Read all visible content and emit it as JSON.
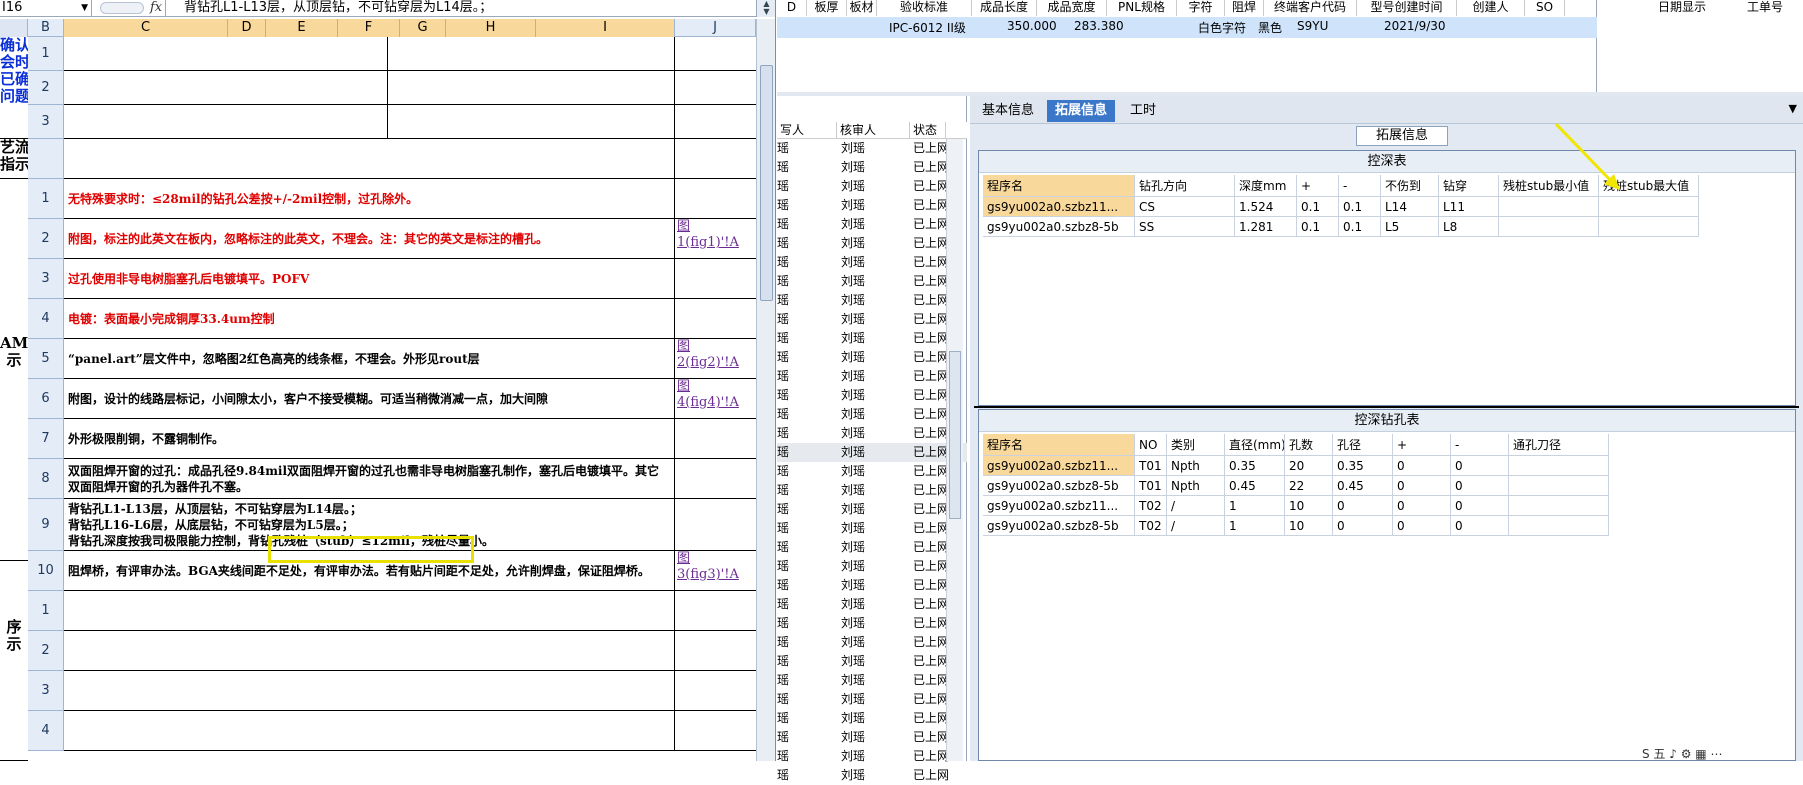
{
  "formula_bar": {
    "name_box": "I16",
    "fx": "fx",
    "formula": "背钻孔L1-L13层，从顶层钻，不可钻穿层为L14层。；"
  },
  "sheet": {
    "columns": [
      "B",
      "C",
      "D",
      "E",
      "F",
      "G",
      "H",
      "I",
      "J"
    ],
    "selected_columns": [
      "C",
      "D",
      "E",
      "F",
      "G",
      "H",
      "I"
    ],
    "left_labels": [
      {
        "text": "确认\n会时\n已确\n问题"
      },
      {
        "text": "艺流程\n指示"
      },
      {
        "text": "AM\n示"
      },
      {
        "text": "序\n示"
      }
    ],
    "rows": [
      {
        "num": "1",
        "text": "",
        "link": "",
        "red": false
      },
      {
        "num": "2",
        "text": "",
        "link": "",
        "red": false
      },
      {
        "num": "3",
        "text": "",
        "link": "",
        "red": false
      },
      {
        "num": "",
        "text": "",
        "link": "",
        "red": false
      },
      {
        "num": "1",
        "text": "无特殊要求时：≤28mil的钻孔公差按+/-2mil控制，过孔除外。",
        "link": "",
        "red": true
      },
      {
        "num": "2",
        "text": "附图，标注的此英文在板内，忽略标注的此英文，不理会。注：其它的英文是标注的槽孔。",
        "link": "图\n1(fig1)'!A",
        "red": true
      },
      {
        "num": "3",
        "text": "过孔使用非导电树脂塞孔后电镀填平。POFV",
        "link": "",
        "red": true
      },
      {
        "num": "4",
        "text": "电镀：表面最小完成铜厚33.4um控制",
        "link": "",
        "red": true
      },
      {
        "num": "5",
        "text": "“panel.art”层文件中，忽略图2红色高亮的线条框，不理会。外形见rout层",
        "link": "图\n2(fig2)'!A",
        "red": false
      },
      {
        "num": "6",
        "text": "附图，设计的线路层标记，小间隙太小，客户不接受模糊。可适当稍微消减一点，加大间隙",
        "link": "图\n4(fig4)'!A",
        "red": false
      },
      {
        "num": "7",
        "text": "外形极限削铜，不露铜制作。",
        "link": "",
        "red": false
      },
      {
        "num": "8",
        "text": "双面阻焊开窗的过孔：成品孔径9.84mil双面阻焊开窗的过孔也需非导电树脂塞孔制作，塞孔后电镀填平。其它双面阻焊开窗的孔为器件孔不塞。",
        "link": "",
        "red": false
      },
      {
        "num": "9",
        "text": "背钻孔L1-L13层，从顶层钻，不可钻穿层为L14层。；\n背钻孔L16-L6层，从底层钻，不可钻穿层为L5层。；\n背钻孔深度按我司极限能力控制，背钻孔残桩（stub）≤12mil，残桩尽量小。",
        "link": "",
        "red": false
      },
      {
        "num": "10",
        "text": "阻焊桥，有评审办法。BGA夹线间距不足处，有评审办法。若有贴片间距不足处，允许削焊盘，保证阻焊桥。",
        "link": "图\n3(fig3)'!A",
        "red": false
      },
      {
        "num": "1",
        "text": "",
        "link": "",
        "red": false
      },
      {
        "num": "2",
        "text": "",
        "link": "",
        "red": false
      },
      {
        "num": "3",
        "text": "",
        "link": "",
        "red": false
      },
      {
        "num": "4",
        "text": "",
        "link": "",
        "red": false
      }
    ]
  },
  "top_table": {
    "headers": [
      "D",
      "板厚",
      "板材",
      "验收标准",
      "成品长度",
      "成品宽度",
      "PNL规格",
      "字符",
      "阻焊",
      "终端客户代码",
      "型号创建时间",
      "创建人",
      "SO"
    ],
    "row": {
      "standard": "IPC-6012 II级",
      "length": "350.000",
      "width": "283.380",
      "char": "白色字符",
      "mask": "黑色",
      "code": "S9YU",
      "time": "2021/9/30"
    },
    "right_headers": [
      "日期显示",
      "工单号"
    ]
  },
  "mid_list": {
    "headers": [
      "写人",
      "核审人",
      "状态"
    ],
    "rows_count": 34,
    "writer": "瑶",
    "auditor": "刘瑶",
    "status": "已上网"
  },
  "right_panel": {
    "tabs": [
      "基本信息",
      "拓展信息",
      "工时"
    ],
    "active_tab": "拓展信息",
    "group_title": "拓展信息",
    "depth_table": {
      "title": "控深表",
      "headers": [
        "程序名",
        "钻孔方向",
        "深度mm",
        "+",
        "-",
        "不伤到",
        "钻穿",
        "残桩stub最小值",
        "残桩stub最大值"
      ],
      "rows": [
        [
          "gs9yu002a0.szbz11...",
          "CS",
          "1.524",
          "0.1",
          "0.1",
          "L14",
          "L11",
          "",
          ""
        ],
        [
          "gs9yu002a0.szbz8-5b",
          "SS",
          "1.281",
          "0.1",
          "0.1",
          "L5",
          "L8",
          "",
          ""
        ]
      ]
    },
    "hole_table": {
      "title": "控深钻孔表",
      "headers": [
        "程序名",
        "NO",
        "类别",
        "直径(mm)",
        "孔数",
        "孔径",
        "+",
        "-",
        "通孔刀径"
      ],
      "rows": [
        [
          "gs9yu002a0.szbz11...",
          "T01",
          "Npth",
          "0.35",
          "20",
          "0.35",
          "0",
          "0",
          ""
        ],
        [
          "gs9yu002a0.szbz8-5b",
          "T01",
          "Npth",
          "0.45",
          "22",
          "0.45",
          "0",
          "0",
          ""
        ],
        [
          "gs9yu002a0.szbz11...",
          "T02",
          "/",
          "1",
          "10",
          "0",
          "0",
          "0",
          ""
        ],
        [
          "gs9yu002a0.szbz8-5b",
          "T02",
          "/",
          "1",
          "10",
          "0",
          "0",
          "0",
          ""
        ]
      ]
    }
  },
  "tray": {
    "text": "S 五 ♪ ⚙ ▦ ⋯"
  }
}
